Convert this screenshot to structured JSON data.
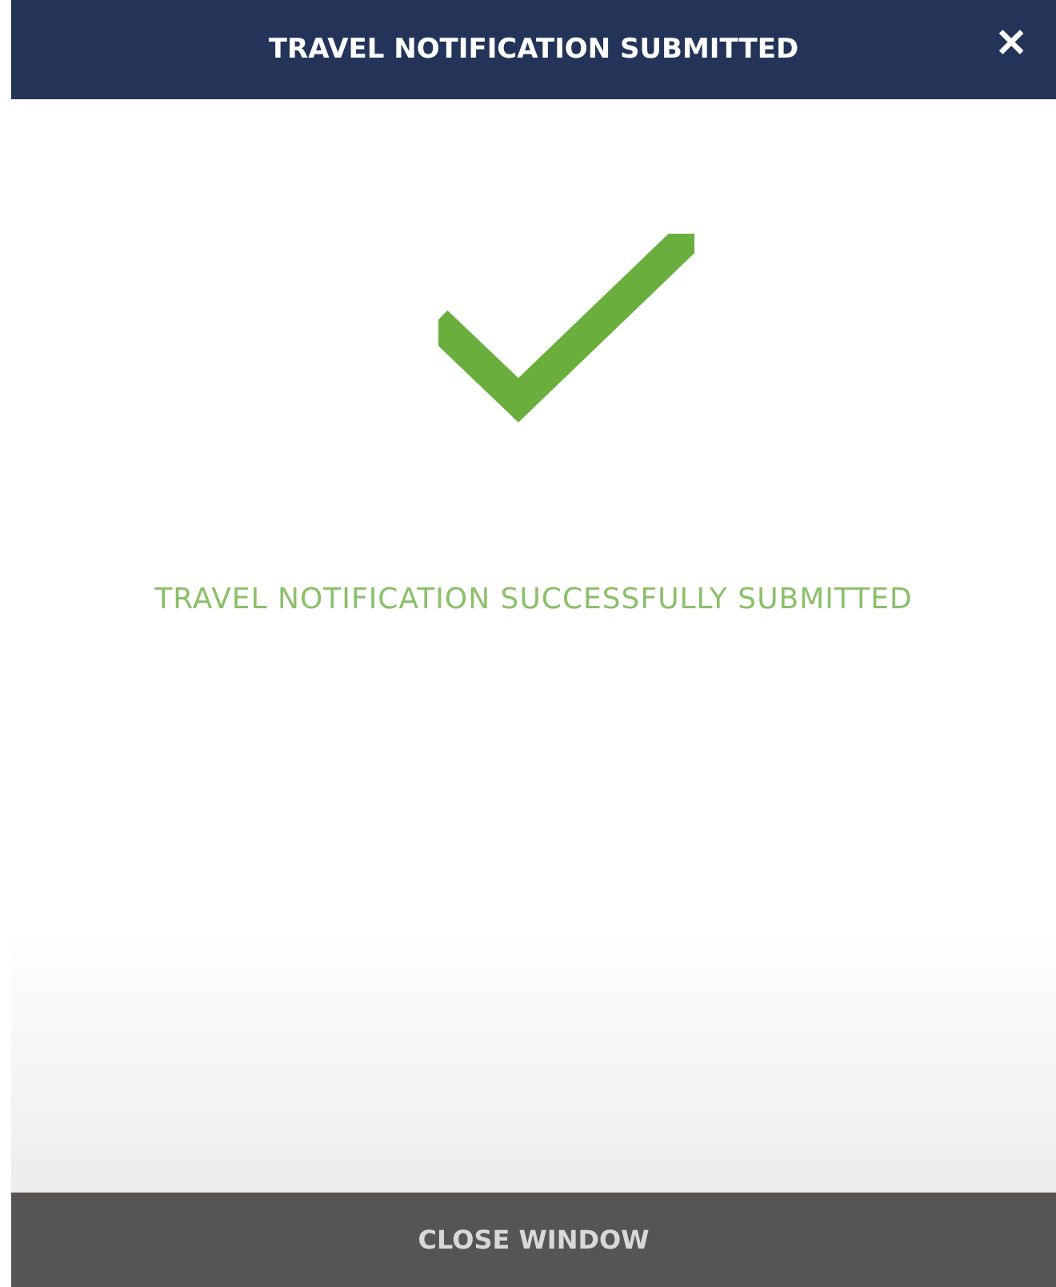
{
  "dialog": {
    "title": "TRAVEL NOTIFICATION SUBMITTED",
    "close_glyph": "✕"
  },
  "message": "TRAVEL NOTIFICATION SUCCESSFULLY SUBMITTED",
  "footer_button": {
    "label": "CLOSE WINDOW"
  }
}
